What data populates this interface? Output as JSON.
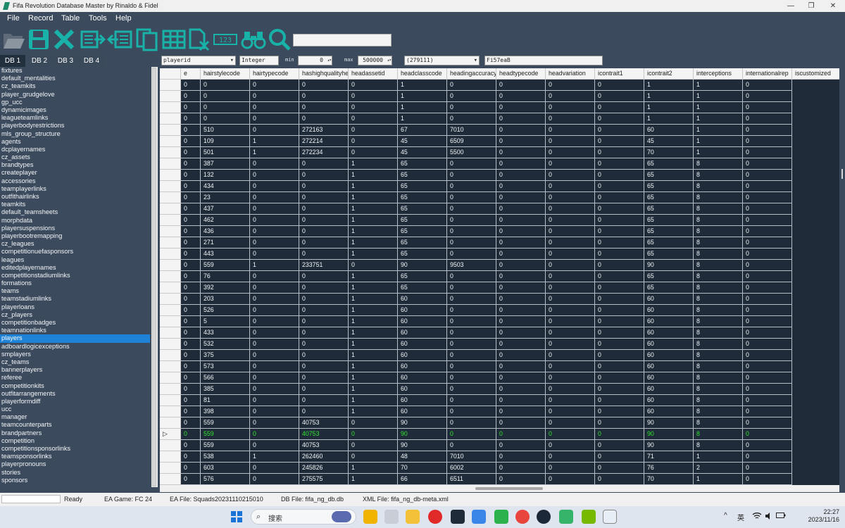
{
  "window": {
    "title": "Fifa Revolution Database Master by Rinaldo & Fidel",
    "controls": [
      "—",
      "❐",
      "✕"
    ]
  },
  "menu": [
    "File",
    "Record",
    "Table",
    "Tools",
    "Help"
  ],
  "toolbar": {
    "buttons": [
      "open-icon",
      "save-icon",
      "close-icon",
      "export-icon",
      "import-icon",
      "copy-icon",
      "table-icon",
      "delete-file-icon",
      "numbering-icon",
      "binoculars-icon",
      "search-icon"
    ],
    "numbering_glyph": "123",
    "search_value": ""
  },
  "db_tabs": [
    "DB 1",
    "DB 2",
    "DB 3",
    "DB 4"
  ],
  "tables": [
    "fixtures",
    "default_mentalities",
    "cz_teamkits",
    "player_grudgelove",
    "gp_ucc",
    "dynamicimages",
    "leagueteamlinks",
    "playerbodyrestrictions",
    "mls_group_structure",
    "agents",
    "dcplayernames",
    "cz_assets",
    "brandtypes",
    "createplayer",
    "accessories",
    "teamplayerlinks",
    "outfithairlinks",
    "teamkits",
    "default_teamsheets",
    "morphdata",
    "playersuspensions",
    "playerbootremapping",
    "cz_leagues",
    "competitionuefasponsors",
    "leagues",
    "editedplayernames",
    "competitionstadiumlinks",
    "formations",
    "teams",
    "teamstadiumlinks",
    "playerloans",
    "cz_players",
    "competitionbadges",
    "teamnationlinks",
    "players",
    "adboardlogicexceptions",
    "smplayers",
    "cz_teams",
    "bannerplayers",
    "referee",
    "competitionkits",
    "outfitarrangements",
    "playerformdiff",
    "ucc",
    "manager",
    "teamcounterparts",
    "brandpartners",
    "competition",
    "competitionsponsorlinks",
    "teamsponsorlinks",
    "playerpronouns",
    "stories",
    "sponsors"
  ],
  "selected_table": "players",
  "filters": {
    "field": "playerid",
    "type": "Integer",
    "min_label": "min",
    "min_value": "0",
    "max_label": "max",
    "max_value": "500000",
    "record_count": "(279111)",
    "search": "Fi57eaB"
  },
  "grid": {
    "columns": [
      "e",
      "hairstylecode",
      "hairtypecode",
      "hashighqualityhe",
      "headassetid",
      "headclasscode",
      "headingaccuracy",
      "headtypecode",
      "headvariation",
      "icontrait1",
      "icontrait2",
      "interceptions",
      "internationalrep",
      "iscustomized"
    ],
    "rows": [
      [
        "0",
        "0",
        "0",
        "0",
        "0",
        "1",
        "0",
        "0",
        "0",
        "0",
        "1",
        "1",
        "0"
      ],
      [
        "0",
        "0",
        "0",
        "0",
        "0",
        "1",
        "0",
        "0",
        "0",
        "0",
        "1",
        "1",
        "0"
      ],
      [
        "0",
        "0",
        "0",
        "0",
        "0",
        "1",
        "0",
        "0",
        "0",
        "0",
        "1",
        "1",
        "0"
      ],
      [
        "0",
        "0",
        "0",
        "0",
        "0",
        "1",
        "0",
        "0",
        "0",
        "0",
        "1",
        "1",
        "0"
      ],
      [
        "0",
        "510",
        "0",
        "272163",
        "0",
        "67",
        "7010",
        "0",
        "0",
        "0",
        "60",
        "1",
        "0"
      ],
      [
        "0",
        "109",
        "1",
        "272214",
        "0",
        "45",
        "6509",
        "0",
        "0",
        "0",
        "45",
        "1",
        "0"
      ],
      [
        "0",
        "501",
        "1",
        "272234",
        "0",
        "45",
        "5500",
        "0",
        "0",
        "0",
        "70",
        "1",
        "0"
      ],
      [
        "0",
        "387",
        "0",
        "0",
        "1",
        "65",
        "0",
        "0",
        "0",
        "0",
        "65",
        "8",
        "0"
      ],
      [
        "0",
        "132",
        "0",
        "0",
        "1",
        "65",
        "0",
        "0",
        "0",
        "0",
        "65",
        "8",
        "0"
      ],
      [
        "0",
        "434",
        "0",
        "0",
        "1",
        "65",
        "0",
        "0",
        "0",
        "0",
        "65",
        "8",
        "0"
      ],
      [
        "0",
        "23",
        "0",
        "0",
        "1",
        "65",
        "0",
        "0",
        "0",
        "0",
        "65",
        "8",
        "0"
      ],
      [
        "0",
        "437",
        "0",
        "0",
        "1",
        "65",
        "0",
        "0",
        "0",
        "0",
        "65",
        "8",
        "0"
      ],
      [
        "0",
        "462",
        "0",
        "0",
        "1",
        "65",
        "0",
        "0",
        "0",
        "0",
        "65",
        "8",
        "0"
      ],
      [
        "0",
        "436",
        "0",
        "0",
        "1",
        "65",
        "0",
        "0",
        "0",
        "0",
        "65",
        "8",
        "0"
      ],
      [
        "0",
        "271",
        "0",
        "0",
        "1",
        "65",
        "0",
        "0",
        "0",
        "0",
        "65",
        "8",
        "0"
      ],
      [
        "0",
        "443",
        "0",
        "0",
        "1",
        "65",
        "0",
        "0",
        "0",
        "0",
        "65",
        "8",
        "0"
      ],
      [
        "0",
        "559",
        "1",
        "233751",
        "0",
        "90",
        "9503",
        "0",
        "0",
        "0",
        "90",
        "8",
        "0"
      ],
      [
        "0",
        "76",
        "0",
        "0",
        "1",
        "65",
        "0",
        "0",
        "0",
        "0",
        "65",
        "8",
        "0"
      ],
      [
        "0",
        "392",
        "0",
        "0",
        "1",
        "65",
        "0",
        "0",
        "0",
        "0",
        "65",
        "8",
        "0"
      ],
      [
        "0",
        "203",
        "0",
        "0",
        "1",
        "60",
        "0",
        "0",
        "0",
        "0",
        "60",
        "8",
        "0"
      ],
      [
        "0",
        "526",
        "0",
        "0",
        "1",
        "60",
        "0",
        "0",
        "0",
        "0",
        "60",
        "8",
        "0"
      ],
      [
        "0",
        "5",
        "0",
        "0",
        "1",
        "60",
        "0",
        "0",
        "0",
        "0",
        "60",
        "8",
        "0"
      ],
      [
        "0",
        "433",
        "0",
        "0",
        "1",
        "60",
        "0",
        "0",
        "0",
        "0",
        "60",
        "8",
        "0"
      ],
      [
        "0",
        "532",
        "0",
        "0",
        "1",
        "60",
        "0",
        "0",
        "0",
        "0",
        "60",
        "8",
        "0"
      ],
      [
        "0",
        "375",
        "0",
        "0",
        "1",
        "60",
        "0",
        "0",
        "0",
        "0",
        "60",
        "8",
        "0"
      ],
      [
        "0",
        "573",
        "0",
        "0",
        "1",
        "60",
        "0",
        "0",
        "0",
        "0",
        "60",
        "8",
        "0"
      ],
      [
        "0",
        "566",
        "0",
        "0",
        "1",
        "60",
        "0",
        "0",
        "0",
        "0",
        "60",
        "8",
        "0"
      ],
      [
        "0",
        "385",
        "0",
        "0",
        "1",
        "60",
        "0",
        "0",
        "0",
        "0",
        "60",
        "8",
        "0"
      ],
      [
        "0",
        "81",
        "0",
        "0",
        "1",
        "60",
        "0",
        "0",
        "0",
        "0",
        "60",
        "8",
        "0"
      ],
      [
        "0",
        "398",
        "0",
        "0",
        "1",
        "60",
        "0",
        "0",
        "0",
        "0",
        "60",
        "8",
        "0"
      ],
      [
        "0",
        "559",
        "0",
        "40753",
        "0",
        "90",
        "0",
        "0",
        "0",
        "0",
        "90",
        "8",
        "0"
      ],
      [
        "0",
        "559",
        "0",
        "40753",
        "0",
        "90",
        "0",
        "0",
        "0",
        "0",
        "90",
        "8",
        "0"
      ],
      [
        "0",
        "559",
        "0",
        "40753",
        "0",
        "90",
        "0",
        "0",
        "0",
        "0",
        "90",
        "8",
        "0"
      ],
      [
        "0",
        "538",
        "1",
        "262460",
        "0",
        "48",
        "7010",
        "0",
        "0",
        "0",
        "71",
        "1",
        "0"
      ],
      [
        "0",
        "603",
        "0",
        "245826",
        "1",
        "70",
        "6002",
        "0",
        "0",
        "0",
        "76",
        "2",
        "0"
      ],
      [
        "0",
        "576",
        "0",
        "275575",
        "1",
        "66",
        "6511",
        "0",
        "0",
        "0",
        "70",
        "1",
        "0"
      ]
    ],
    "current_row_index": 31,
    "current_row_marker": "▷"
  },
  "status": {
    "state": "Ready",
    "ea_game": "EA Game: FC 24",
    "ea_file": "EA File: Squads20231110215010",
    "db_file": "DB File: fifa_ng_db.db",
    "xml_file": "XML File: fifa_ng_db-meta.xml"
  },
  "taskbar": {
    "search_label": "搜索",
    "icons": [
      "windows-start-icon",
      "search-icon",
      "widgets-icon",
      "game-icon",
      "task-view-icon",
      "file-explorer-icon",
      "netease-music-icon",
      "terminal-icon",
      "store-icon",
      "wechat-icon",
      "chrome-icon",
      "steam-icon",
      "edge-icon",
      "nvidia-icon",
      "fifa-db-master-icon"
    ],
    "tray": {
      "chevron": "^",
      "ime": "英",
      "time": "22:27",
      "date": "2023/11/16"
    }
  },
  "colors": {
    "app_bg": "#3b4a5c",
    "grid_bg": "#1f2b38",
    "toolbar_icon": "#19b2a8",
    "selection": "#1e82d7",
    "current_row_text": "#31e431"
  }
}
